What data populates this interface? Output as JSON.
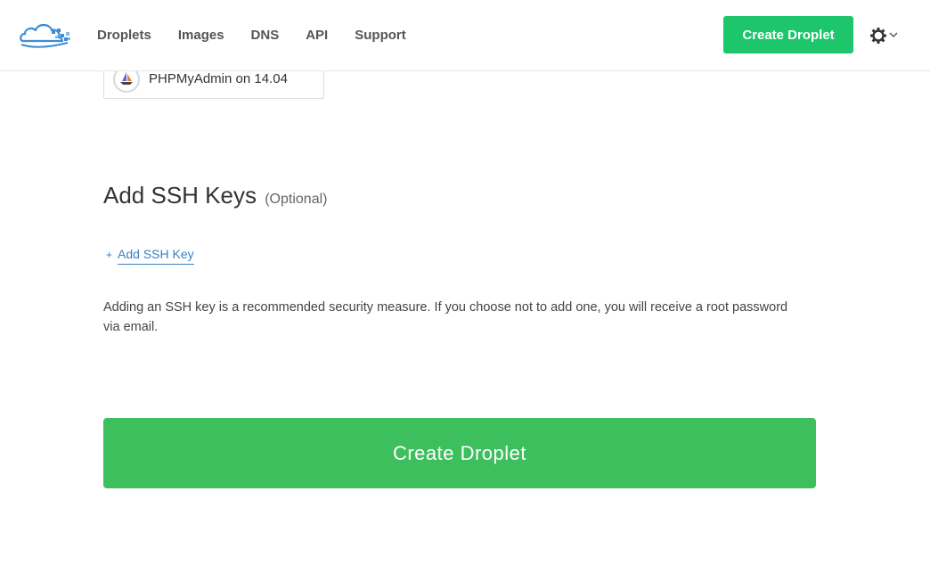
{
  "header": {
    "nav": [
      {
        "label": "Droplets"
      },
      {
        "label": "Images"
      },
      {
        "label": "DNS"
      },
      {
        "label": "API"
      },
      {
        "label": "Support"
      }
    ],
    "create_button_label": "Create Droplet"
  },
  "selected_image": {
    "label": "PHPMyAdmin on 14.04",
    "icon": "sailboat-icon"
  },
  "ssh": {
    "title": "Add SSH Keys",
    "optional": "(Optional)",
    "add_plus": "+",
    "add_link_label": "Add SSH Key",
    "description": "Adding an SSH key is a recommended security measure. If you choose not to add one, you will receive a root password via email."
  },
  "footer": {
    "create_button_label": "Create Droplet"
  },
  "colors": {
    "primary_green": "#1dc66a",
    "big_button_green": "#3cbf5c",
    "link_blue": "#3a7fc1",
    "logo_blue": "#3a8ed8"
  }
}
